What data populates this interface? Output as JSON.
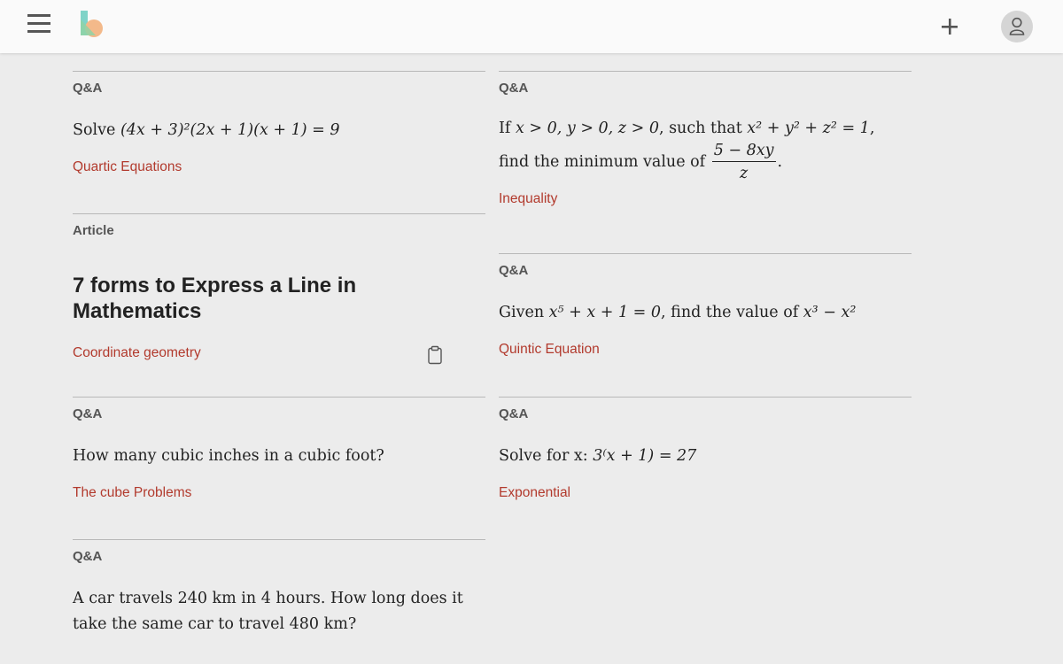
{
  "header": {
    "menu_icon": "hamburger-menu-icon",
    "logo_icon": "site-logo",
    "add_icon": "plus-icon",
    "user_icon": "user-avatar-icon"
  },
  "cards_left": [
    {
      "type": "Q&A",
      "body_prefix": "Solve ",
      "math": "(4x + 3)²(2x + 1)(x + 1) = 9",
      "tag": "Quartic Equations"
    },
    {
      "type": "Article",
      "title": "7 forms to Express a Line in Mathematics",
      "tag": "Coordinate geometry",
      "icon": "clipboard-icon"
    },
    {
      "type": "Q&A",
      "body": "How many cubic inches in a cubic foot?",
      "tag": "The cube Problems"
    },
    {
      "type": "Q&A",
      "body": "A car travels 240 km in 4 hours. How long does it take the same car to travel 480 km?"
    }
  ],
  "cards_right": [
    {
      "type": "Q&A",
      "line1_prefix": "If ",
      "line1_math": "x > 0, y > 0, z > 0",
      "line1_mid": ", such that ",
      "line1_math2": "x² + y² + z² = 1",
      "line1_end": ",",
      "line2_prefix": "find the minimum value of ",
      "frac_num": "5 − 8xy",
      "frac_den": "z",
      "line2_end": ".",
      "tag": "Inequality"
    },
    {
      "type": "Q&A",
      "body_prefix": "Given ",
      "math1": "x⁵ + x + 1 = 0",
      "body_mid": ", find the value of ",
      "math2": "x³ − x²",
      "tag": "Quintic Equation"
    },
    {
      "type": "Q&A",
      "body_prefix": "Solve for x: ",
      "math": "3⁽x + 1) = 27",
      "tag": "Exponential"
    }
  ],
  "colors": {
    "tag": "#b23a2d",
    "background": "#ececec",
    "topbar": "#fafafa",
    "divider": "#b8b8b8"
  }
}
